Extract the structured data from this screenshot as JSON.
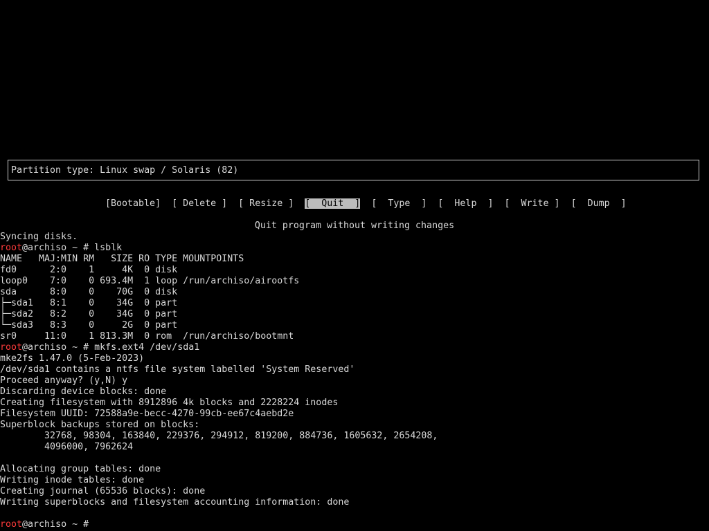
{
  "partition_info": {
    "text": "Partition type: Linux swap / Solaris (82)"
  },
  "menu": {
    "items": [
      {
        "label": "[Bootable]"
      },
      {
        "label": "[ Delete ]"
      },
      {
        "label": "[ Resize ]"
      },
      {
        "label": "[  Quit  ]",
        "selected": true
      },
      {
        "label": "[  Type  ]"
      },
      {
        "label": "[  Help  ]"
      },
      {
        "label": "[  Write ]"
      },
      {
        "label": "[  Dump  ]"
      }
    ],
    "hint": "Quit program without writing changes"
  },
  "terminal": {
    "prompt_user": "root",
    "prompt_rest": "@archiso ~ # ",
    "lines": [
      "Syncing disks.",
      "PROMPT:lsblk",
      "NAME   MAJ:MIN RM   SIZE RO TYPE MOUNTPOINTS",
      "fd0      2:0    1     4K  0 disk",
      "loop0    7:0    0 693.4M  1 loop /run/archiso/airootfs",
      "sda      8:0    0    70G  0 disk",
      "├─sda1   8:1    0    34G  0 part",
      "├─sda2   8:2    0    34G  0 part",
      "└─sda3   8:3    0     2G  0 part",
      "sr0     11:0    1 813.3M  0 rom  /run/archiso/bootmnt",
      "PROMPT:mkfs.ext4 /dev/sda1",
      "mke2fs 1.47.0 (5-Feb-2023)",
      "/dev/sda1 contains a ntfs file system labelled 'System Reserved'",
      "Proceed anyway? (y,N) y",
      "Discarding device blocks: done",
      "Creating filesystem with 8912896 4k blocks and 2228224 inodes",
      "Filesystem UUID: 72588a9e-becc-4270-99cb-ee67c4aebd2e",
      "Superblock backups stored on blocks:",
      "        32768, 98304, 163840, 229376, 294912, 819200, 884736, 1605632, 2654208,",
      "        4096000, 7962624",
      "",
      "Allocating group tables: done",
      "Writing inode tables: done",
      "Creating journal (65536 blocks): done",
      "Writing superblocks and filesystem accounting information: done",
      "",
      "PROMPT:"
    ]
  }
}
